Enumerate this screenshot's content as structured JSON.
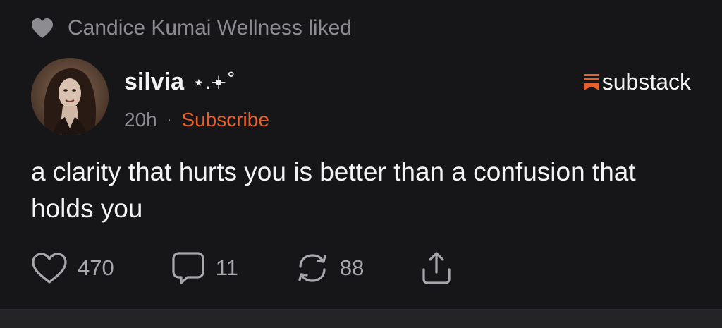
{
  "liked": {
    "text": "Candice Kumai Wellness liked",
    "icon": "heart-filled-icon"
  },
  "author": {
    "name": "silvia",
    "decoration": "⋆.𖥔˚",
    "avatar": "avatar-photo"
  },
  "meta": {
    "time": "20h",
    "separator": "·",
    "subscribe_label": "Subscribe"
  },
  "brand": {
    "label": "substack",
    "icon": "substack-logo-icon",
    "color": "#e8612c"
  },
  "post": {
    "text": "a clarity that hurts you is better than a confusion that holds you"
  },
  "actions": {
    "likes": "470",
    "comments": "11",
    "restacks": "88",
    "like_icon": "heart-outline-icon",
    "comment_icon": "comment-bubble-icon",
    "restack_icon": "restack-arrows-icon",
    "share_icon": "share-upload-icon"
  },
  "colors": {
    "background": "#161618",
    "muted_text": "#8d8d91",
    "accent": "#e8612c",
    "primary_text": "#f2f2f2"
  }
}
